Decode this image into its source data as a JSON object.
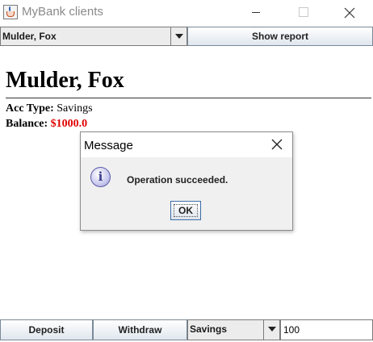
{
  "window": {
    "title": "MyBank clients",
    "icon": "java-cup-icon"
  },
  "toolbar": {
    "client_selected": "Mulder, Fox",
    "show_report_label": "Show report"
  },
  "report": {
    "client_name": "Mulder, Fox",
    "acc_type_label": "Acc Type:",
    "acc_type_value": "Savings",
    "balance_label": "Balance:",
    "balance_value": "$1000.0",
    "balance_color": "#e00000"
  },
  "dialog": {
    "title": "Message",
    "message": "Operation succeeded.",
    "ok_label": "OK",
    "icon": "info-icon"
  },
  "actions": {
    "deposit_label": "Deposit",
    "withdraw_label": "Withdraw",
    "account_type_selected": "Savings",
    "amount_value": "100"
  }
}
